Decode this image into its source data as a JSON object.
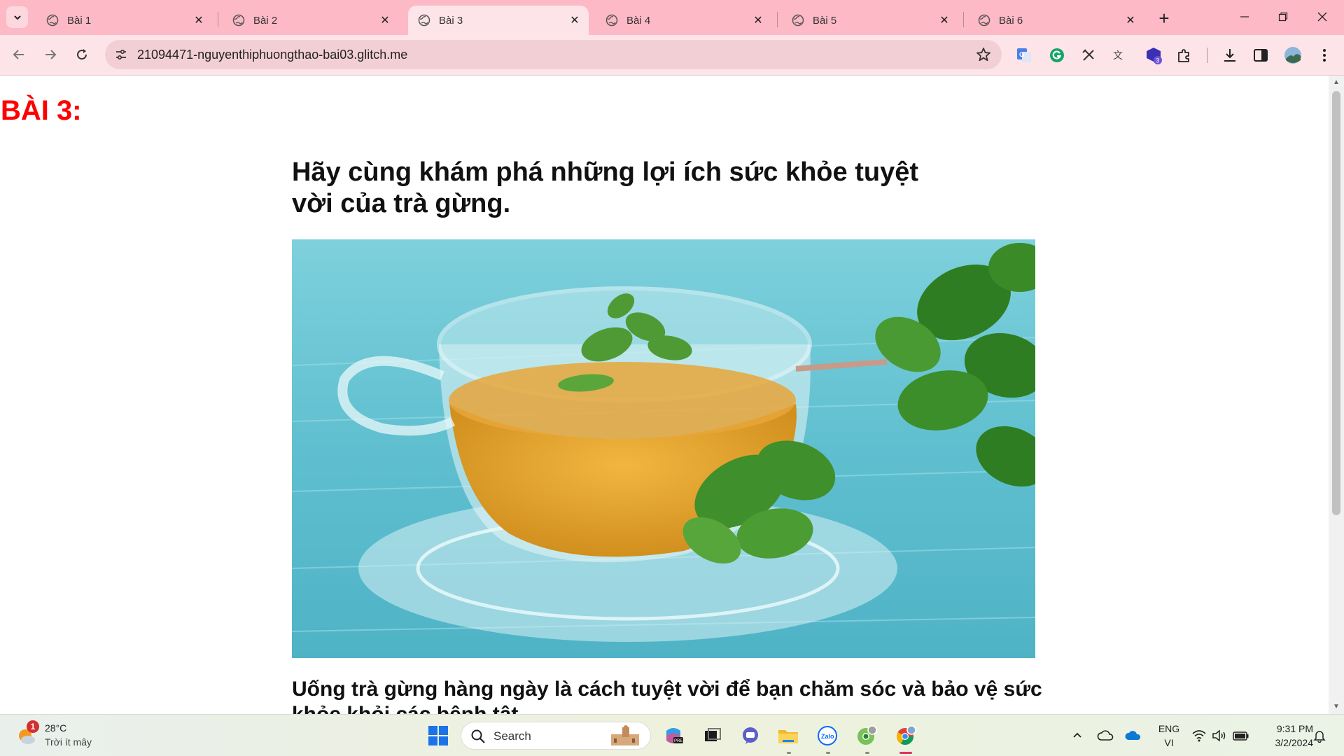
{
  "browser": {
    "tabs": [
      {
        "title": "Bài 1",
        "active": false
      },
      {
        "title": "Bài 2",
        "active": false
      },
      {
        "title": "Bài 3",
        "active": true
      },
      {
        "title": "Bài 4",
        "active": false
      },
      {
        "title": "Bài 5",
        "active": false
      },
      {
        "title": "Bài 6",
        "active": false
      }
    ],
    "url": "21094471-nguyenthiphuongthao-bai03.glitch.me",
    "profile_badge": "3"
  },
  "page": {
    "heading": "BÀI 3:",
    "title": "Hãy cùng khám phá những lợi ích sức khỏe tuyệt vời của trà gừng.",
    "body_text": "Uống trà gừng hàng ngày là cách tuyệt vời để bạn chăm sóc và bảo vệ sức khỏe khỏi các bệnh tật"
  },
  "taskbar": {
    "weather_badge": "1",
    "temperature": "28°C",
    "weather_desc": "Trời ít mây",
    "search_label": "Search",
    "lang_primary": "ENG",
    "lang_secondary": "VI",
    "time": "9:31 PM",
    "date": "3/2/2024"
  },
  "colors": {
    "tab_strip": "#fdb9c6",
    "toolbar": "#fde4e8",
    "heading_red": "#ff0000"
  }
}
